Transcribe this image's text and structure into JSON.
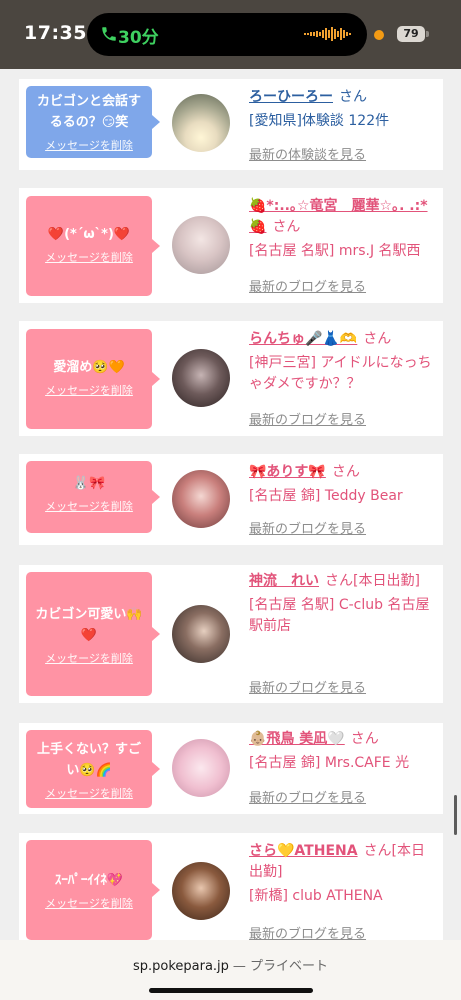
{
  "status_bar": {
    "time": "17:35",
    "call_duration": "30分",
    "battery": "79"
  },
  "items": [
    {
      "bubble_text": "カビゴンと会話するるの？😏笑",
      "delete_label": "メッセージを削除",
      "name": "ろーひーろー",
      "honorific": "さん",
      "desc": "[愛知県]体験談 122件",
      "link": "最新の体験談を見る"
    },
    {
      "bubble_text": "❤️(*´ω`*)❤️",
      "delete_label": "メッセージを削除",
      "name": "🍓*:..｡☆竜宮　麗華☆｡. .:*🍓",
      "honorific": "さん",
      "desc": "[名古屋 名駅] mrs.J 名駅西",
      "link": "最新のブログを見る"
    },
    {
      "bubble_text": "愛溜め🥺🧡",
      "delete_label": "メッセージを削除",
      "name": "らんちゅ🎤👗🫶",
      "honorific": "さん",
      "desc": "[神戸三宮] アイドルになっちゃダメですか？？",
      "link": "最新のブログを見る"
    },
    {
      "bubble_text": "🐰🎀",
      "delete_label": "メッセージを削除",
      "name": "🎀ありす🎀",
      "honorific": "さん",
      "desc": "[名古屋 錦] Teddy Bear",
      "link": "最新のブログを見る"
    },
    {
      "bubble_text": "カビゴン可愛い🙌❤️",
      "delete_label": "メッセージを削除",
      "name": "神流　れい",
      "honorific": "さん[本日出勤]",
      "desc": "[名古屋 名駅] C-club 名古屋駅前店",
      "link": "最新のブログを見る"
    },
    {
      "bubble_text": "上手くない？すごい🥺🌈",
      "delete_label": "メッセージを削除",
      "name": "👶🏼飛鳥 美凪🤍",
      "honorific": "さん",
      "desc": "[名古屋 錦] Mrs.CAFE 光",
      "link": "最新のブログを見る"
    },
    {
      "bubble_text": "ｽｰﾊﾟｰｲｲﾈ💖",
      "delete_label": "メッセージを削除",
      "name": "さら💛ATHENA",
      "honorific": "さん[本日出勤]",
      "desc": "[新橋] club ATHENA",
      "link": "最新のブログを見る"
    }
  ],
  "browser": {
    "url": "sp.pokepara.jp",
    "mode": "— プライベート"
  }
}
